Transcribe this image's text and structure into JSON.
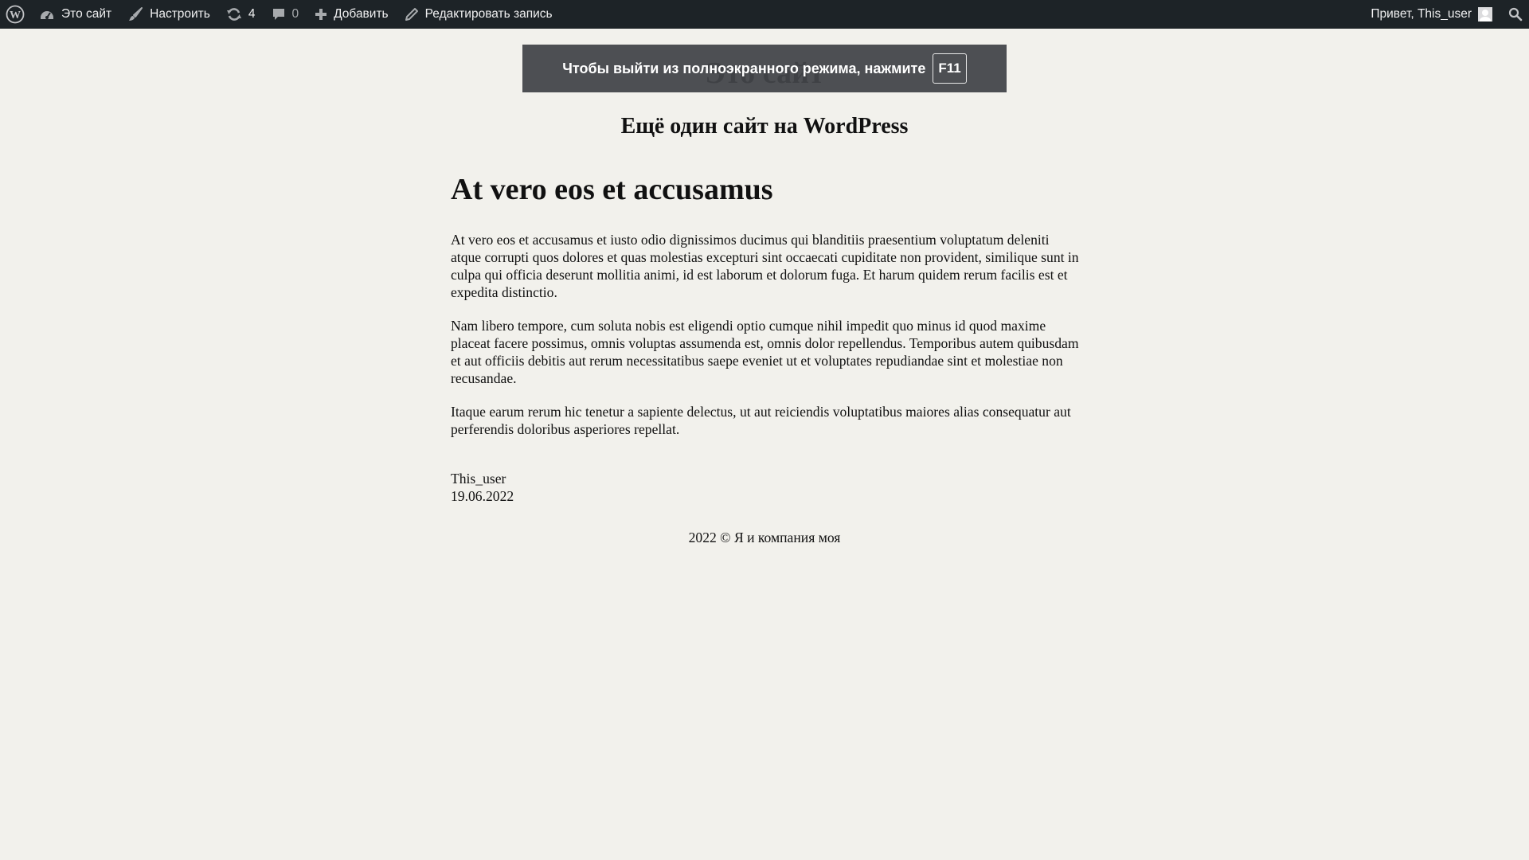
{
  "adminbar": {
    "site_name": "Это сайт",
    "customize": "Настроить",
    "updates_count": "4",
    "comments_count": "0",
    "add_new": "Добавить",
    "edit_post": "Редактировать запись",
    "greeting": "Привет, This_user",
    "icons": [
      "wordpress-logo-icon",
      "dashboard-icon",
      "brush-icon",
      "updates-icon",
      "comment-icon",
      "plus-icon",
      "pencil-icon",
      "avatar",
      "search-icon"
    ]
  },
  "site": {
    "title": "Это сайт",
    "description": "Ещё один сайт на WordPress"
  },
  "fullscreen_notice": {
    "text": "Чтобы выйти из полноэкранного режима, нажмите",
    "key": "F11"
  },
  "post": {
    "title": "At vero eos et accusamus",
    "paragraphs": [
      "At vero eos et accusamus et iusto odio dignissimos ducimus qui blanditiis praesentium voluptatum deleniti atque corrupti quos dolores et quas molestias excepturi sint occaecati cupiditate non provident, similique sunt in culpa qui officia deserunt mollitia animi, id est laborum et dolorum fuga. Et harum quidem rerum facilis est et expedita distinctio.",
      "Nam libero tempore, cum soluta nobis est eligendi optio cumque nihil impedit quo minus id quod maxime placeat facere possimus, omnis voluptas assumenda est, omnis dolor repellendus. Temporibus autem quibusdam et aut officiis debitis aut rerum necessitatibus saepe eveniet ut et voluptates repudiandae sint et molestiae non recusandae.",
      "Itaque earum rerum hic tenetur a sapiente delectus, ut aut reiciendis voluptatibus maiores alias consequatur aut perferendis doloribus asperiores repellat."
    ],
    "author": "This_user",
    "date": "19.06.2022"
  },
  "footer": {
    "text": "2022 © Я и компания моя"
  },
  "colors": {
    "adminbar_bg": "#1d2327",
    "page_bg": "#f2f1ec",
    "overlay_bg": "#414347"
  }
}
